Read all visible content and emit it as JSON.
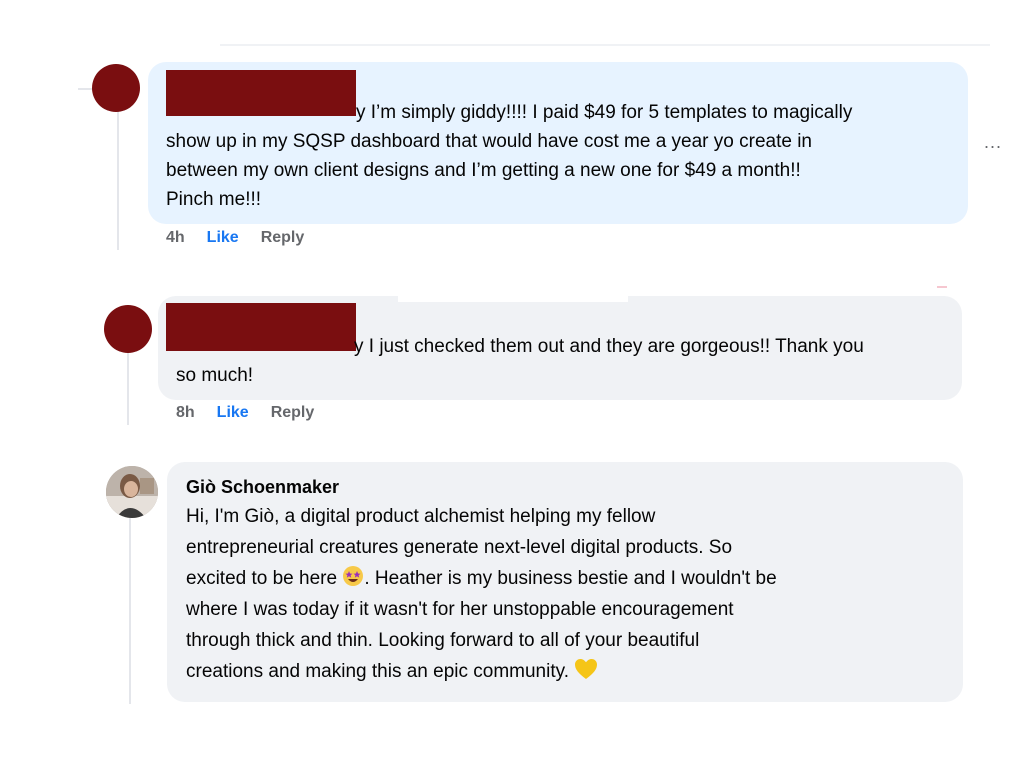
{
  "comments": [
    {
      "author_hidden": true,
      "text_line_1": "y I’m simply giddy!!!! I paid $49 for 5 templates to magically",
      "text_line_2": "show up in my SQSP dashboard that would have cost me a year yo create in",
      "text_line_3": "between my own client designs and I’m getting a new one for $49 a month!!",
      "text_line_4": "Pinch me!!!",
      "time": "4h",
      "like_label": "Like",
      "reply_label": "Reply"
    },
    {
      "author_hidden": true,
      "text_line_1": "y I just checked them out and they are gorgeous!! Thank you",
      "text_line_2": "so much!",
      "time": "8h",
      "like_label": "Like",
      "reply_label": "Reply"
    },
    {
      "author": "Giò Schoenmaker",
      "text_line_1": "Hi, I'm Giò, a digital product alchemist helping my fellow",
      "text_line_2": "entrepreneurial creatures generate next-level digital products. So",
      "text_line_3a": "excited to be here ",
      "text_line_3b": ". Heather is my business bestie and I wouldn't be",
      "text_line_4": "where I was today if it wasn't for her unstoppable encouragement",
      "text_line_5": "through thick and thin. Looking forward to all of your beautiful",
      "text_line_6": "creations and making this an epic community. ",
      "emoji_1": "star-struck-emoji",
      "emoji_2": "yellow-heart-emoji"
    }
  ],
  "more_label": "...",
  "colors": {
    "redaction": "#7a0e10",
    "blue_bubble": "#e7f3ff",
    "grey_bubble": "#f0f2f5",
    "like": "#1877f2",
    "meta": "#65676b"
  }
}
